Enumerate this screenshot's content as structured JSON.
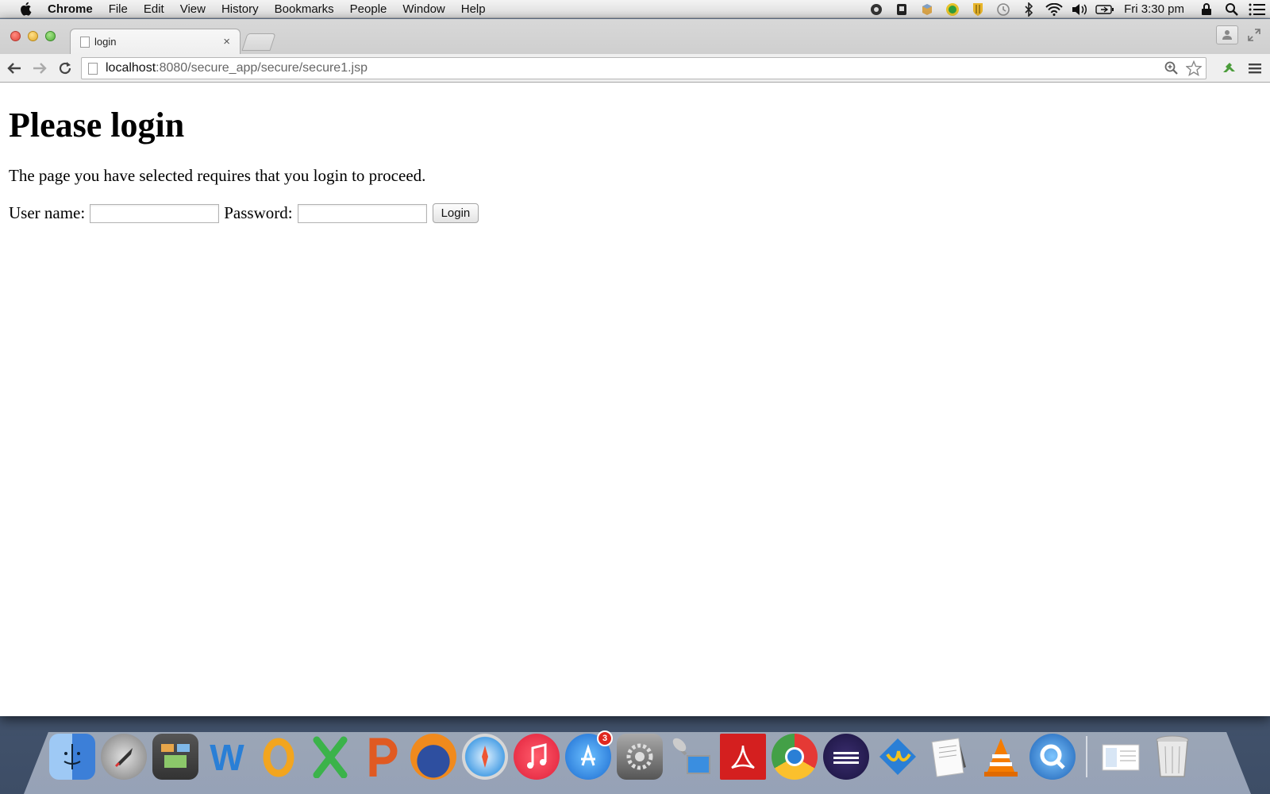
{
  "menubar": {
    "app_name": "Chrome",
    "items": [
      "File",
      "Edit",
      "View",
      "History",
      "Bookmarks",
      "People",
      "Window",
      "Help"
    ],
    "clock": "Fri 3:30 pm"
  },
  "tab": {
    "title": "login",
    "close": "×"
  },
  "omnibox": {
    "host": "localhost",
    "path": ":8080/secure_app/secure/secure1.jsp"
  },
  "page": {
    "heading": "Please login",
    "message": "The page you have selected requires that you login to proceed.",
    "username_label": "User name:",
    "username_value": "",
    "password_label": "Password:",
    "password_value": "",
    "login_button": "Login"
  },
  "dock": {
    "app_store_badge": "3"
  },
  "colors": {
    "word_blue": "#2a7fd6",
    "outlook_orange": "#f2a51f",
    "excel_green": "#3bb34a",
    "powerpoint_orange": "#e05a22",
    "acrobat_red": "#d41f1f"
  }
}
